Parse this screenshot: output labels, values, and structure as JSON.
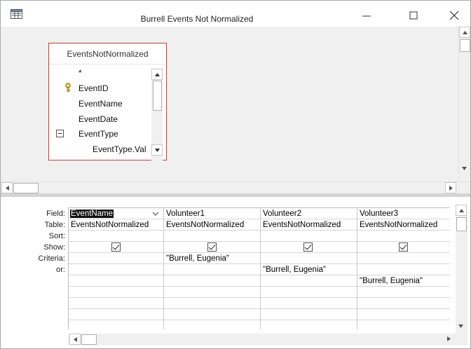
{
  "window": {
    "title": "Burrell Events Not Normalized"
  },
  "table_box": {
    "title": "EventsNotNormalized",
    "fields": [
      "*",
      "EventID",
      "EventName",
      "EventDate",
      "EventType",
      "EventType.Val"
    ]
  },
  "grid": {
    "row_labels": [
      "Field:",
      "Table:",
      "Sort:",
      "Show:",
      "Criteria:",
      "or:"
    ],
    "columns": [
      {
        "field": "EventName",
        "table": "EventsNotNormalized",
        "show": true,
        "criteria": "",
        "or1": "",
        "or2": ""
      },
      {
        "field": "Volunteer1",
        "table": "EventsNotNormalized",
        "show": true,
        "criteria": "\"Burrell,  Eugenia\"",
        "or1": "",
        "or2": ""
      },
      {
        "field": "Volunteer2",
        "table": "EventsNotNormalized",
        "show": true,
        "criteria": "",
        "or1": "\"Burrell,  Eugenia\"",
        "or2": ""
      },
      {
        "field": "Volunteer3",
        "table": "EventsNotNormalized",
        "show": true,
        "criteria": "",
        "or1": "",
        "or2": "\"Burrell,  Eugenia\""
      }
    ]
  },
  "icons": {
    "app": "query-design-icon",
    "minimize": "minimize-icon",
    "maximize": "maximize-icon",
    "close": "close-icon",
    "primary_key": "key-icon"
  },
  "colors": {
    "table_border": "#b4473c",
    "pane_background": "#f0f0f0"
  }
}
